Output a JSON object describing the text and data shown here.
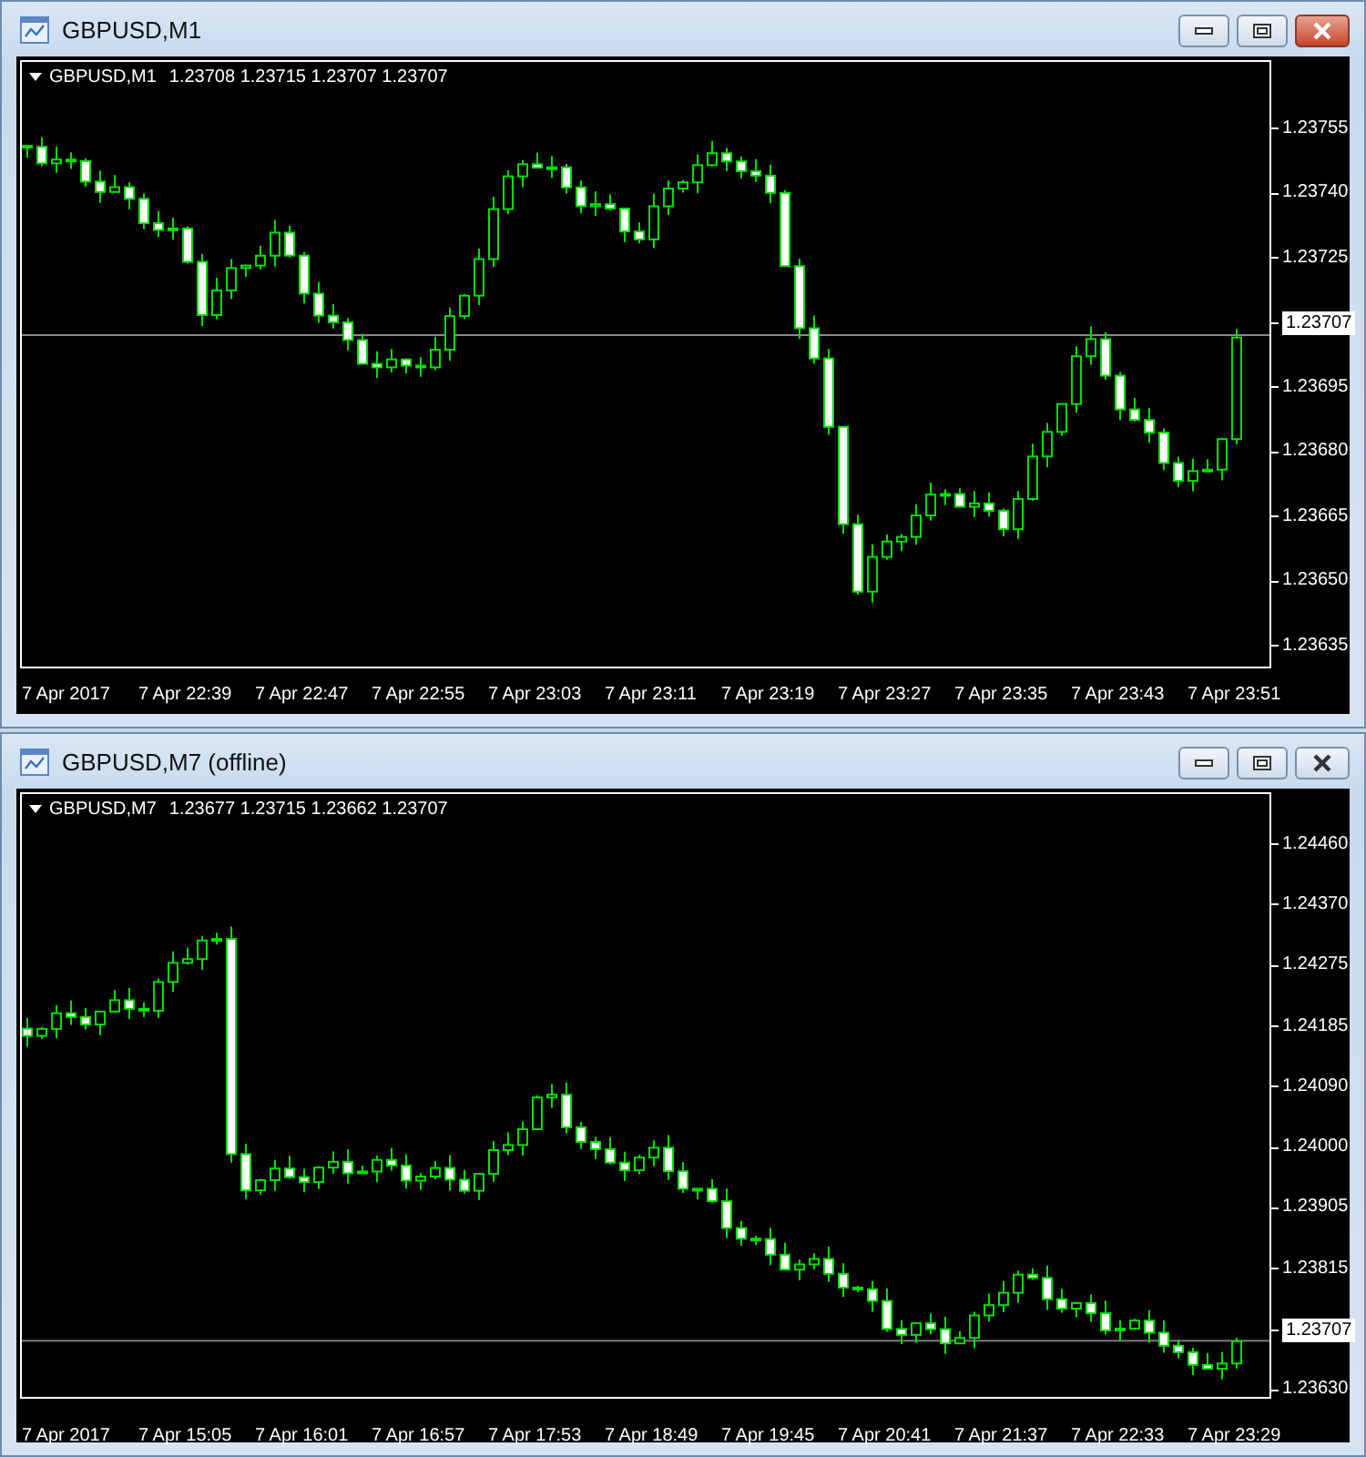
{
  "windows": [
    {
      "title": "GBPUSD,M1",
      "active": true,
      "header": {
        "symbol": "GBPUSD,M1",
        "quote": "1.23708 1.23715 1.23707 1.23707"
      },
      "price_axis": [
        {
          "kind": "tick",
          "label": "1.23755"
        },
        {
          "kind": "tick",
          "label": "1.23740"
        },
        {
          "kind": "tick",
          "label": "1.23725"
        },
        {
          "kind": "price",
          "label": "1.23707"
        },
        {
          "kind": "tick",
          "label": "1.23695"
        },
        {
          "kind": "tick",
          "label": "1.23680"
        },
        {
          "kind": "tick",
          "label": "1.23665"
        },
        {
          "kind": "tick",
          "label": "1.23650"
        },
        {
          "kind": "tick",
          "label": "1.23635"
        }
      ],
      "time_axis": [
        "7 Apr 2017",
        "7 Apr 22:39",
        "7 Apr 22:47",
        "7 Apr 22:55",
        "7 Apr 23:03",
        "7 Apr 23:11",
        "7 Apr 23:19",
        "7 Apr 23:27",
        "7 Apr 23:35",
        "7 Apr 23:43",
        "7 Apr 23:51"
      ]
    },
    {
      "title": "GBPUSD,M7 (offline)",
      "active": false,
      "header": {
        "symbol": "GBPUSD,M7",
        "quote": "1.23677 1.23715 1.23662 1.23707"
      },
      "price_axis": [
        {
          "kind": "tick",
          "label": "1.24460"
        },
        {
          "kind": "tick",
          "label": "1.24370"
        },
        {
          "kind": "tick",
          "label": "1.24275"
        },
        {
          "kind": "tick",
          "label": "1.24185"
        },
        {
          "kind": "tick",
          "label": "1.24090"
        },
        {
          "kind": "tick",
          "label": "1.24000"
        },
        {
          "kind": "tick",
          "label": "1.23905"
        },
        {
          "kind": "tick",
          "label": "1.23815"
        },
        {
          "kind": "price",
          "label": "1.23707"
        },
        {
          "kind": "tick",
          "label": "1.23630"
        }
      ],
      "time_axis": [
        "7 Apr 2017",
        "7 Apr 15:05",
        "7 Apr 16:01",
        "7 Apr 16:57",
        "7 Apr 17:53",
        "7 Apr 18:49",
        "7 Apr 19:45",
        "7 Apr 20:41",
        "7 Apr 21:37",
        "7 Apr 22:33",
        "7 Apr 23:29"
      ]
    }
  ]
}
